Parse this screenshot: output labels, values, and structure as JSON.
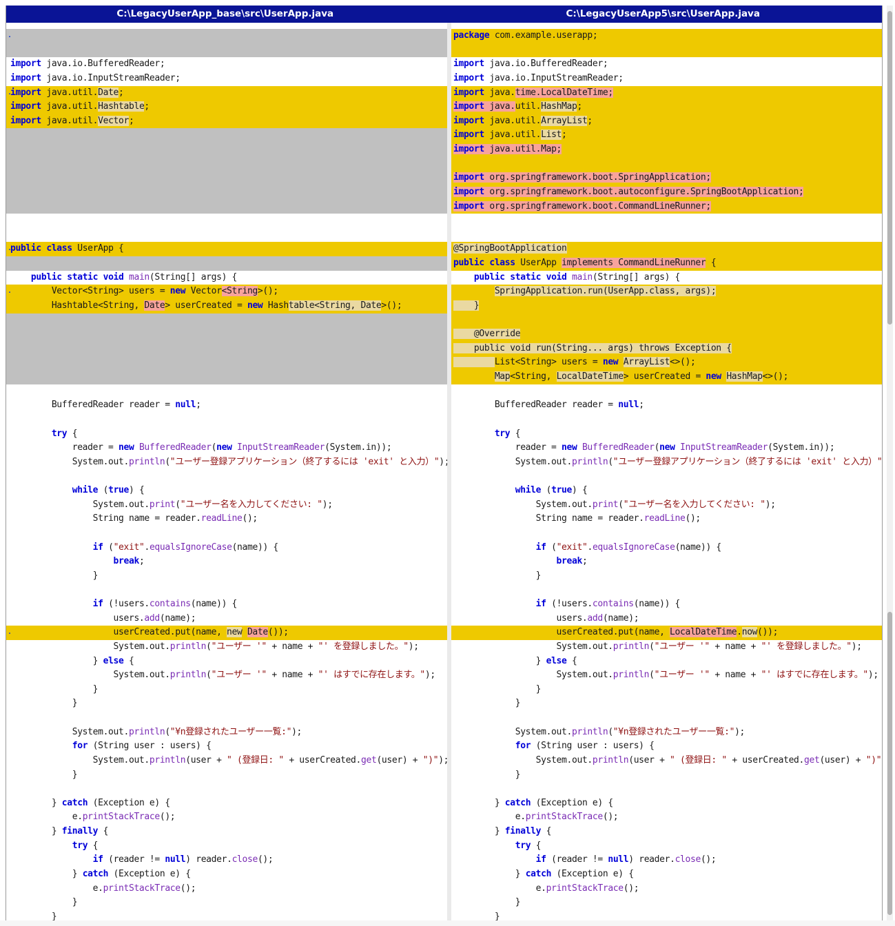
{
  "header": {
    "left_title": "C:\\LegacyUserApp_base\\src\\UserApp.java",
    "right_title": "C:\\LegacyUserApp5\\src\\UserApp.java"
  },
  "colors": {
    "header_bg": "#0a1496",
    "changed_line": "#eec900",
    "missing_line": "#c0c0c0",
    "word_diff": "#f8a39c",
    "keyword": "#0000d8",
    "string": "#8f1313",
    "method": "#7a2cb4"
  },
  "marker": ".",
  "left_lines": [
    {
      "cls": "gray",
      "mark": true,
      "html": ""
    },
    {
      "cls": "gray",
      "html": ""
    },
    {
      "cls": "",
      "html": "<span class=\"k\">import</span> java.io.BufferedReader;"
    },
    {
      "cls": "",
      "html": "<span class=\"k\">import</span> java.io.InputStreamReader;"
    },
    {
      "cls": "chg",
      "mark": true,
      "html": "<span class=\"k\">import</span> java.util.<span class=\"hl2\">Date</span>;"
    },
    {
      "cls": "chg",
      "html": "<span class=\"k\">import</span> java.util.<span class=\"hl2\">Hashtable</span>;"
    },
    {
      "cls": "chg",
      "html": "<span class=\"k\">import</span> java.util.<span class=\"hl2\">Vector</span>;"
    },
    {
      "cls": "gray",
      "html": ""
    },
    {
      "cls": "gray",
      "html": ""
    },
    {
      "cls": "gray",
      "html": ""
    },
    {
      "cls": "gray",
      "html": ""
    },
    {
      "cls": "gray",
      "html": ""
    },
    {
      "cls": "gray",
      "html": ""
    },
    {
      "cls": "",
      "html": ""
    },
    {
      "cls": "",
      "html": ""
    },
    {
      "cls": "chg",
      "mark": true,
      "html": "<span class=\"k\">public class</span> UserApp {"
    },
    {
      "cls": "gray",
      "html": ""
    },
    {
      "cls": "",
      "html": "    <span class=\"k\">public static void</span> <span class=\"m\">main</span>(String[] args) {"
    },
    {
      "cls": "chg",
      "mark": true,
      "html": "        Vector&lt;String&gt; users = <span class=\"k\">new</span> Vector<span class=\"hl\">&lt;String</span>&gt;();"
    },
    {
      "cls": "chg",
      "html": "        Hashtable&lt;String, <span class=\"hl\">Date</span>&gt; userCreated = <span class=\"k\">new</span> Hash<span class=\"hl2\">table&lt;String, Date</span>&gt;();"
    },
    {
      "cls": "gray",
      "html": ""
    },
    {
      "cls": "gray",
      "html": ""
    },
    {
      "cls": "gray",
      "html": ""
    },
    {
      "cls": "gray",
      "html": ""
    },
    {
      "cls": "gray",
      "html": ""
    },
    {
      "cls": "",
      "html": ""
    },
    {
      "cls": "",
      "html": "        BufferedReader reader = <span class=\"k\">null</span>;"
    },
    {
      "cls": "",
      "html": ""
    },
    {
      "cls": "",
      "html": "        <span class=\"k\">try</span> {"
    },
    {
      "cls": "",
      "html": "            reader = <span class=\"k\">new</span> <span class=\"m\">BufferedReader</span>(<span class=\"k\">new</span> <span class=\"m\">InputStreamReader</span>(System.in));"
    },
    {
      "cls": "",
      "html": "            System.out.<span class=\"m\">println</span>(<span class=\"s\">\"ユーザー登録アプリケーション（終了するには 'exit' と入力）\"</span>);"
    },
    {
      "cls": "",
      "html": ""
    },
    {
      "cls": "",
      "html": "            <span class=\"k\">while</span> (<span class=\"k\">true</span>) {"
    },
    {
      "cls": "",
      "html": "                System.out.<span class=\"m\">print</span>(<span class=\"s\">\"ユーザー名を入力してください: \"</span>);"
    },
    {
      "cls": "",
      "html": "                String name = reader.<span class=\"m\">readLine</span>();"
    },
    {
      "cls": "",
      "html": ""
    },
    {
      "cls": "",
      "html": "                <span class=\"k\">if</span> (<span class=\"s\">\"exit\"</span>.<span class=\"m\">equalsIgnoreCase</span>(name)) {"
    },
    {
      "cls": "",
      "html": "                    <span class=\"k\">break</span>;"
    },
    {
      "cls": "",
      "html": "                }"
    },
    {
      "cls": "",
      "html": ""
    },
    {
      "cls": "",
      "html": "                <span class=\"k\">if</span> (!users.<span class=\"m\">contains</span>(name)) {"
    },
    {
      "cls": "",
      "html": "                    users.<span class=\"m\">add</span>(name);"
    },
    {
      "cls": "chg",
      "mark": true,
      "html": "                    userCreated.put(name, <span class=\"hl2\">new</span> <span class=\"hl\">Date</span>());"
    },
    {
      "cls": "",
      "html": "                    System.out.<span class=\"m\">println</span>(<span class=\"s\">\"ユーザー '\"</span> + name + <span class=\"s\">\"' を登録しました。\"</span>);"
    },
    {
      "cls": "",
      "html": "                } <span class=\"k\">else</span> {"
    },
    {
      "cls": "",
      "html": "                    System.out.<span class=\"m\">println</span>(<span class=\"s\">\"ユーザー '\"</span> + name + <span class=\"s\">\"' はすでに存在します。\"</span>);"
    },
    {
      "cls": "",
      "html": "                }"
    },
    {
      "cls": "",
      "html": "            }"
    },
    {
      "cls": "",
      "html": ""
    },
    {
      "cls": "",
      "html": "            System.out.<span class=\"m\">println</span>(<span class=\"s\">\"¥n登録されたユーザー一覧:\"</span>);"
    },
    {
      "cls": "",
      "html": "            <span class=\"k\">for</span> (String user : users) {"
    },
    {
      "cls": "",
      "html": "                System.out.<span class=\"m\">println</span>(user + <span class=\"s\">\" (登録日: \"</span> + userCreated.<span class=\"m\">get</span>(user) + <span class=\"s\">\")\"</span>);"
    },
    {
      "cls": "",
      "html": "            }"
    },
    {
      "cls": "",
      "html": ""
    },
    {
      "cls": "",
      "html": "        } <span class=\"k\">catch</span> (Exception e) {"
    },
    {
      "cls": "",
      "html": "            e.<span class=\"m\">printStackTrace</span>();"
    },
    {
      "cls": "",
      "html": "        } <span class=\"k\">finally</span> {"
    },
    {
      "cls": "",
      "html": "            <span class=\"k\">try</span> {"
    },
    {
      "cls": "",
      "html": "                <span class=\"k\">if</span> (reader != <span class=\"k\">null</span>) reader.<span class=\"m\">close</span>();"
    },
    {
      "cls": "",
      "html": "            } <span class=\"k\">catch</span> (Exception e) {"
    },
    {
      "cls": "",
      "html": "                e.<span class=\"m\">printStackTrace</span>();"
    },
    {
      "cls": "",
      "html": "            }"
    },
    {
      "cls": "",
      "html": "        }"
    },
    {
      "cls": "",
      "html": "    }"
    },
    {
      "cls": "",
      "html": "}"
    }
  ],
  "right_lines": [
    {
      "cls": "chg",
      "html": "<span class=\"k\">package</span> com.example.userapp;"
    },
    {
      "cls": "chg",
      "html": ""
    },
    {
      "cls": "",
      "html": "<span class=\"k\">import</span> java.io.BufferedReader;"
    },
    {
      "cls": "",
      "html": "<span class=\"k\">import</span> java.io.InputStreamReader;"
    },
    {
      "cls": "chg",
      "html": "<span class=\"k\">import</span> java.<span class=\"hl\">time.LocalDateTime;</span>"
    },
    {
      "cls": "chg",
      "html": "<span class=\"hl\"><span class=\"k\">import</span> java.</span>util.<span class=\"hl2\">HashMap</span>;"
    },
    {
      "cls": "chg",
      "html": "<span class=\"k\">import</span> java.util.<span class=\"hl2\">ArrayList</span>;"
    },
    {
      "cls": "chg",
      "html": "<span class=\"k\">import</span> java.util.<span class=\"hl2\">List</span>;"
    },
    {
      "cls": "chg",
      "html": "<span class=\"hl\"><span class=\"k\">import</span> java.util.Map;</span>"
    },
    {
      "cls": "chg",
      "html": ""
    },
    {
      "cls": "chg",
      "html": "<span class=\"hl\"><span class=\"k\">import</span> org.springframework.boot.SpringApplication;</span>"
    },
    {
      "cls": "chg",
      "html": "<span class=\"hl\"><span class=\"k\">import</span> org.springframework.boot.autoconfigure.SpringBootApplication;</span>"
    },
    {
      "cls": "chg",
      "html": "<span class=\"hl\"><span class=\"k\">import</span> org.springframework.boot.CommandLineRunner;</span>"
    },
    {
      "cls": "",
      "html": ""
    },
    {
      "cls": "",
      "html": ""
    },
    {
      "cls": "chg",
      "html": "<span class=\"hl2\">@SpringBootApplication</span>"
    },
    {
      "cls": "chg",
      "html": "<span class=\"k\">public class</span> UserApp <span class=\"hl\">implements CommandLineRunner</span> {"
    },
    {
      "cls": "",
      "html": "    <span class=\"k\">public static void</span> <span class=\"m\">main</span>(String[] args) {"
    },
    {
      "cls": "chg",
      "html": "        <span class=\"hl2\">SpringApplication.run(UserApp.class, args);</span>"
    },
    {
      "cls": "chg",
      "html": "<span class=\"hl2\">    }</span>"
    },
    {
      "cls": "chg",
      "html": ""
    },
    {
      "cls": "chg",
      "html": "<span class=\"hl2\">    @Override</span>"
    },
    {
      "cls": "chg",
      "html": "<span class=\"hl2\">    public void run(String... args) throws Exception {</span>"
    },
    {
      "cls": "chg",
      "html": "<span class=\"hl2\">        </span>List&lt;String&gt; users = <span class=\"k\">new</span> <span class=\"hl2\">ArrayList</span>&lt;&gt;();"
    },
    {
      "cls": "chg",
      "html": "        <span class=\"hl2\">Map</span>&lt;String, <span class=\"hl2\">LocalDateTime</span>&gt; userCreated = <span class=\"k\">new</span> <span class=\"hl2\">HashMap</span>&lt;&gt;();"
    },
    {
      "cls": "",
      "html": ""
    },
    {
      "cls": "",
      "html": "        BufferedReader reader = <span class=\"k\">null</span>;"
    },
    {
      "cls": "",
      "html": ""
    },
    {
      "cls": "",
      "html": "        <span class=\"k\">try</span> {"
    },
    {
      "cls": "",
      "html": "            reader = <span class=\"k\">new</span> <span class=\"m\">BufferedReader</span>(<span class=\"k\">new</span> <span class=\"m\">InputStreamReader</span>(System.in));"
    },
    {
      "cls": "",
      "html": "            System.out.<span class=\"m\">println</span>(<span class=\"s\">\"ユーザー登録アプリケーション（終了するには 'exit' と入力）\"</span>);"
    },
    {
      "cls": "",
      "html": ""
    },
    {
      "cls": "",
      "html": "            <span class=\"k\">while</span> (<span class=\"k\">true</span>) {"
    },
    {
      "cls": "",
      "html": "                System.out.<span class=\"m\">print</span>(<span class=\"s\">\"ユーザー名を入力してください: \"</span>);"
    },
    {
      "cls": "",
      "html": "                String name = reader.<span class=\"m\">readLine</span>();"
    },
    {
      "cls": "",
      "html": ""
    },
    {
      "cls": "",
      "html": "                <span class=\"k\">if</span> (<span class=\"s\">\"exit\"</span>.<span class=\"m\">equalsIgnoreCase</span>(name)) {"
    },
    {
      "cls": "",
      "html": "                    <span class=\"k\">break</span>;"
    },
    {
      "cls": "",
      "html": "                }"
    },
    {
      "cls": "",
      "html": ""
    },
    {
      "cls": "",
      "html": "                <span class=\"k\">if</span> (!users.<span class=\"m\">contains</span>(name)) {"
    },
    {
      "cls": "",
      "html": "                    users.<span class=\"m\">add</span>(name);"
    },
    {
      "cls": "chg",
      "html": "                    userCreated.put(name, <span class=\"hl\">LocalDateTime</span>.<span class=\"hl2\">now</span>());"
    },
    {
      "cls": "",
      "html": "                    System.out.<span class=\"m\">println</span>(<span class=\"s\">\"ユーザー '\"</span> + name + <span class=\"s\">\"' を登録しました。\"</span>);"
    },
    {
      "cls": "",
      "html": "                } <span class=\"k\">else</span> {"
    },
    {
      "cls": "",
      "html": "                    System.out.<span class=\"m\">println</span>(<span class=\"s\">\"ユーザー '\"</span> + name + <span class=\"s\">\"' はすでに存在します。\"</span>);"
    },
    {
      "cls": "",
      "html": "                }"
    },
    {
      "cls": "",
      "html": "            }"
    },
    {
      "cls": "",
      "html": ""
    },
    {
      "cls": "",
      "html": "            System.out.<span class=\"m\">println</span>(<span class=\"s\">\"¥n登録されたユーザー一覧:\"</span>);"
    },
    {
      "cls": "",
      "html": "            <span class=\"k\">for</span> (String user : users) {"
    },
    {
      "cls": "",
      "html": "                System.out.<span class=\"m\">println</span>(user + <span class=\"s\">\" (登録日: \"</span> + userCreated.<span class=\"m\">get</span>(user) + <span class=\"s\">\")\"</span>);"
    },
    {
      "cls": "",
      "html": "            }"
    },
    {
      "cls": "",
      "html": ""
    },
    {
      "cls": "",
      "html": "        } <span class=\"k\">catch</span> (Exception e) {"
    },
    {
      "cls": "",
      "html": "            e.<span class=\"m\">printStackTrace</span>();"
    },
    {
      "cls": "",
      "html": "        } <span class=\"k\">finally</span> {"
    },
    {
      "cls": "",
      "html": "            <span class=\"k\">try</span> {"
    },
    {
      "cls": "",
      "html": "                <span class=\"k\">if</span> (reader != <span class=\"k\">null</span>) reader.<span class=\"m\">close</span>();"
    },
    {
      "cls": "",
      "html": "            } <span class=\"k\">catch</span> (Exception e) {"
    },
    {
      "cls": "",
      "html": "                e.<span class=\"m\">printStackTrace</span>();"
    },
    {
      "cls": "",
      "html": "            }"
    },
    {
      "cls": "",
      "html": "        }"
    },
    {
      "cls": "",
      "html": "    }"
    },
    {
      "cls": "",
      "html": "}"
    }
  ]
}
